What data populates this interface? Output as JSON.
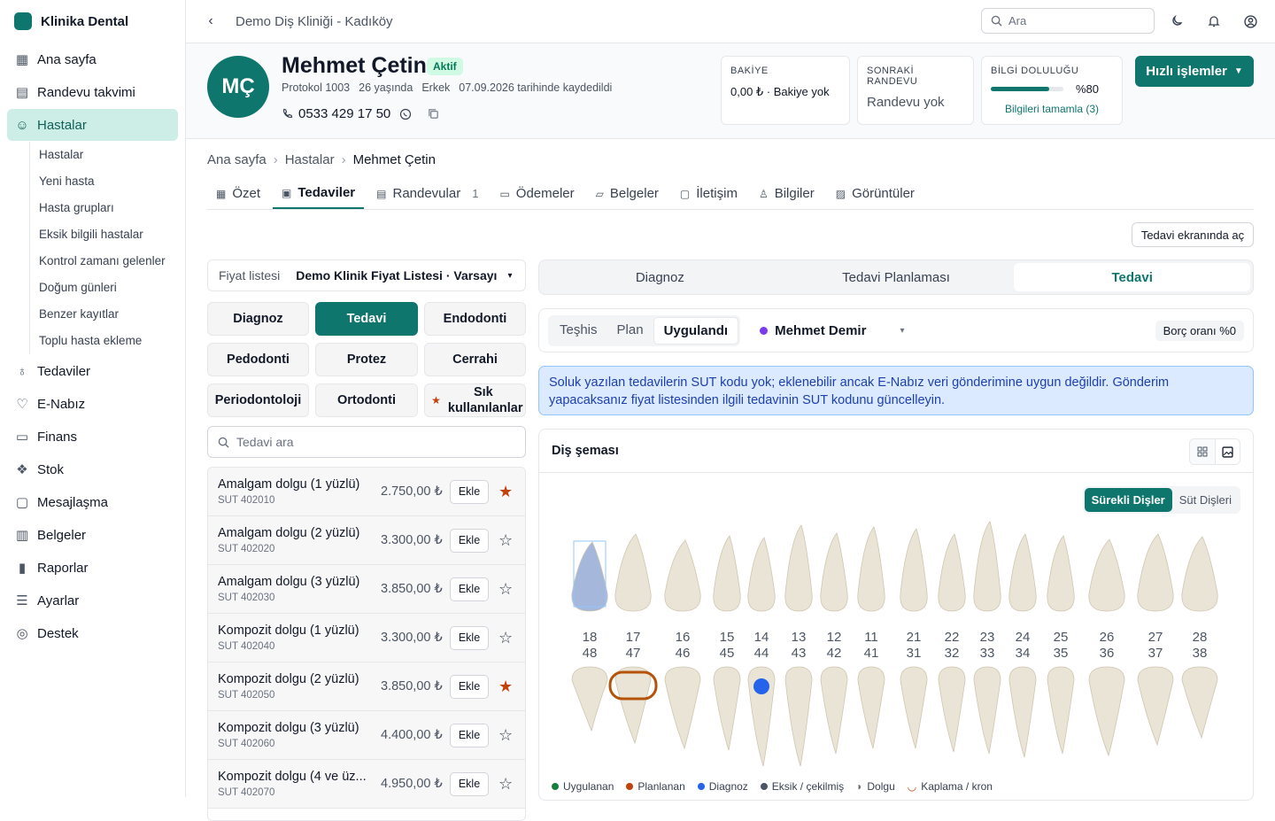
{
  "brand": {
    "name": "Klinika Dental"
  },
  "nav": [
    {
      "label": "Ana sayfa",
      "icon": "grid-icon"
    },
    {
      "label": "Randevu takvimi",
      "icon": "calendar-icon"
    },
    {
      "label": "Hastalar",
      "icon": "users-icon",
      "active": true
    },
    {
      "label": "Tedaviler",
      "icon": "tooth-icon"
    },
    {
      "label": "E-Nabız",
      "icon": "heartbeat-icon"
    },
    {
      "label": "Finans",
      "icon": "wallet-icon"
    },
    {
      "label": "Stok",
      "icon": "boxes-icon"
    },
    {
      "label": "Mesajlaşma",
      "icon": "message-icon"
    },
    {
      "label": "Belgeler",
      "icon": "document-icon"
    },
    {
      "label": "Raporlar",
      "icon": "bar-chart-icon"
    },
    {
      "label": "Ayarlar",
      "icon": "sliders-icon"
    },
    {
      "label": "Destek",
      "icon": "headset-icon"
    }
  ],
  "subnav": [
    "Hastalar",
    "Yeni hasta",
    "Hasta grupları",
    "Eksik bilgili hastalar",
    "Kontrol zamanı gelenler",
    "Doğum günleri",
    "Benzer kayıtlar",
    "Toplu hasta ekleme"
  ],
  "topbar": {
    "clinic": "Demo Diş Kliniği - Kadıköy",
    "search_placeholder": "Ara"
  },
  "patient": {
    "initials": "MÇ",
    "name": "Mehmet Çetin",
    "status": "Aktif",
    "protocol": "Protokol 1003",
    "age": "26 yaşında",
    "gender": "Erkek",
    "registered": "07.09.2026 tarihinde kaydedildi",
    "phone": "0533 429 17 50"
  },
  "stats": {
    "balance_label": "BAKİYE",
    "balance_value": "0,00 ₺ · Bakiye yok",
    "next_label": "SONRAKİ RANDEVU",
    "next_value": "Randevu yok",
    "info_label": "BİLGİ DOLULUĞU",
    "info_percent": "%80",
    "info_fill": 0.8,
    "info_link": "Bilgileri tamamla (3)"
  },
  "quick_actions": "Hızlı işlemler",
  "breadcrumb": [
    "Ana sayfa",
    "Hastalar",
    "Mehmet Çetin"
  ],
  "tabs": [
    {
      "label": "Özet",
      "icon": "grid-icon"
    },
    {
      "label": "Tedaviler",
      "icon": "clipboard-icon",
      "active": true
    },
    {
      "label": "Randevular",
      "icon": "calendar-icon",
      "count": "1"
    },
    {
      "label": "Ödemeler",
      "icon": "card-icon"
    },
    {
      "label": "Belgeler",
      "icon": "folder-icon"
    },
    {
      "label": "İletişim",
      "icon": "message-icon"
    },
    {
      "label": "Bilgiler",
      "icon": "user-icon"
    },
    {
      "label": "Görüntüler",
      "icon": "image-icon"
    }
  ],
  "open_screen": "Tedavi ekranında aç",
  "pricelist": {
    "label": "Fiyat listesi",
    "value": "Demo Klinik Fiyat Listesi · Varsayı"
  },
  "categories": [
    {
      "label": "Diagnoz"
    },
    {
      "label": "Tedavi",
      "active": true
    },
    {
      "label": "Endodonti"
    },
    {
      "label": "Pedodonti"
    },
    {
      "label": "Protez"
    },
    {
      "label": "Cerrahi"
    },
    {
      "label": "Periodontoloji"
    },
    {
      "label": "Ortodonti"
    },
    {
      "label": "Sık kullanılanlar",
      "star": true
    }
  ],
  "treatment_search": "Tedavi ara",
  "add_label": "Ekle",
  "treatments": [
    {
      "name": "Amalgam dolgu (1 yüzlü)",
      "sut": "SUT 402010",
      "price": "2.750,00 ₺",
      "fav": true
    },
    {
      "name": "Amalgam dolgu (2 yüzlü)",
      "sut": "SUT 402020",
      "price": "3.300,00 ₺",
      "fav": false
    },
    {
      "name": "Amalgam dolgu (3 yüzlü)",
      "sut": "SUT 402030",
      "price": "3.850,00 ₺",
      "fav": false
    },
    {
      "name": "Kompozit dolgu (1 yüzlü)",
      "sut": "SUT 402040",
      "price": "3.300,00 ₺",
      "fav": false
    },
    {
      "name": "Kompozit dolgu (2 yüzlü)",
      "sut": "SUT 402050",
      "price": "3.850,00 ₺",
      "fav": true
    },
    {
      "name": "Kompozit dolgu (3 yüzlü)",
      "sut": "SUT 402060",
      "price": "4.400,00 ₺",
      "fav": false
    },
    {
      "name": "Kompozit dolgu (4 ve üz...",
      "sut": "SUT 402070",
      "price": "4.950,00 ₺",
      "fav": false
    }
  ],
  "modes": [
    {
      "label": "Diagnoz"
    },
    {
      "label": "Tedavi Planlaması"
    },
    {
      "label": "Tedavi",
      "active": true
    }
  ],
  "stages": [
    {
      "label": "Teşhis"
    },
    {
      "label": "Plan"
    },
    {
      "label": "Uygulandı",
      "active": true
    }
  ],
  "doctor": "Mehmet Demir",
  "debt": "Borç oranı %0",
  "alert": "Soluk yazılan tedavilerin SUT kodu yok; eklenebilir ancak E-Nabız veri gönderimine uygun değildir. Gönderim yapacaksanız fiyat listesinden ilgili tedavinin SUT kodunu güncelleyin.",
  "chart": {
    "title": "Diş şeması",
    "permanent": "Sürekli Dişler",
    "milk": "Süt Dişleri",
    "upper": [
      "18",
      "17",
      "16",
      "15",
      "14",
      "13",
      "12",
      "11",
      "21",
      "22",
      "23",
      "24",
      "25",
      "26",
      "27",
      "28"
    ],
    "lower": [
      "48",
      "47",
      "46",
      "45",
      "44",
      "43",
      "42",
      "41",
      "31",
      "32",
      "33",
      "34",
      "35",
      "36",
      "37",
      "38"
    ],
    "marks": {
      "upper_selected": "18",
      "lower_planned": "47",
      "lower_diagnosis": "44"
    }
  },
  "legend": [
    {
      "label": "Uygulanan",
      "color": "#15803d"
    },
    {
      "label": "Planlanan",
      "color": "#c2410c"
    },
    {
      "label": "Diagnoz",
      "color": "#2563eb"
    },
    {
      "label": "Eksik / çekilmiş",
      "color": "#4b5563"
    },
    {
      "label": "Dolgu",
      "icon": "filling-icon"
    },
    {
      "label": "Kaplama / kron",
      "icon": "crown-icon"
    }
  ]
}
